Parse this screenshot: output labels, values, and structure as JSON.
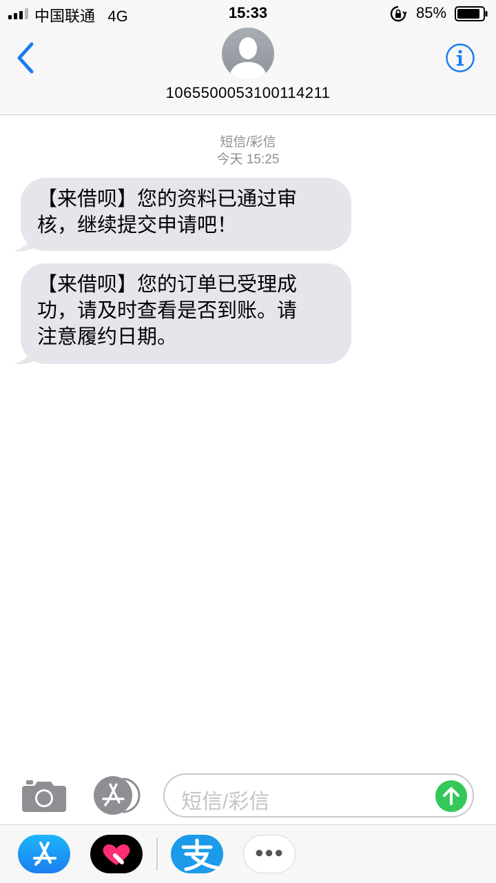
{
  "status_bar": {
    "carrier": "中国联通",
    "network": "4G",
    "time": "15:33",
    "battery": "85%"
  },
  "header": {
    "contact": "1065500053100114211",
    "back_icon": "chevron-left-icon",
    "info_icon": "info-icon",
    "accent_color": "#1b7cf2"
  },
  "conversation": {
    "service_label": "短信/彩信",
    "timestamp": "今天 15:25",
    "messages": [
      {
        "lines": [
          "【来借呗】您的资料已通过审",
          "核，继续提交申请吧！"
        ]
      },
      {
        "lines": [
          "【来借呗】您的订单已受理成",
          "功，请及时查看是否到账。请",
          "注意履约日期。"
        ]
      }
    ],
    "bubble_color": "#e6e5eb"
  },
  "input_bar": {
    "placeholder": "短信/彩信",
    "send_color": "#34c759"
  },
  "app_drawer": {
    "apps": [
      "app-store-icon",
      "digital-touch-icon",
      "alipay-icon",
      "more-icon"
    ]
  }
}
